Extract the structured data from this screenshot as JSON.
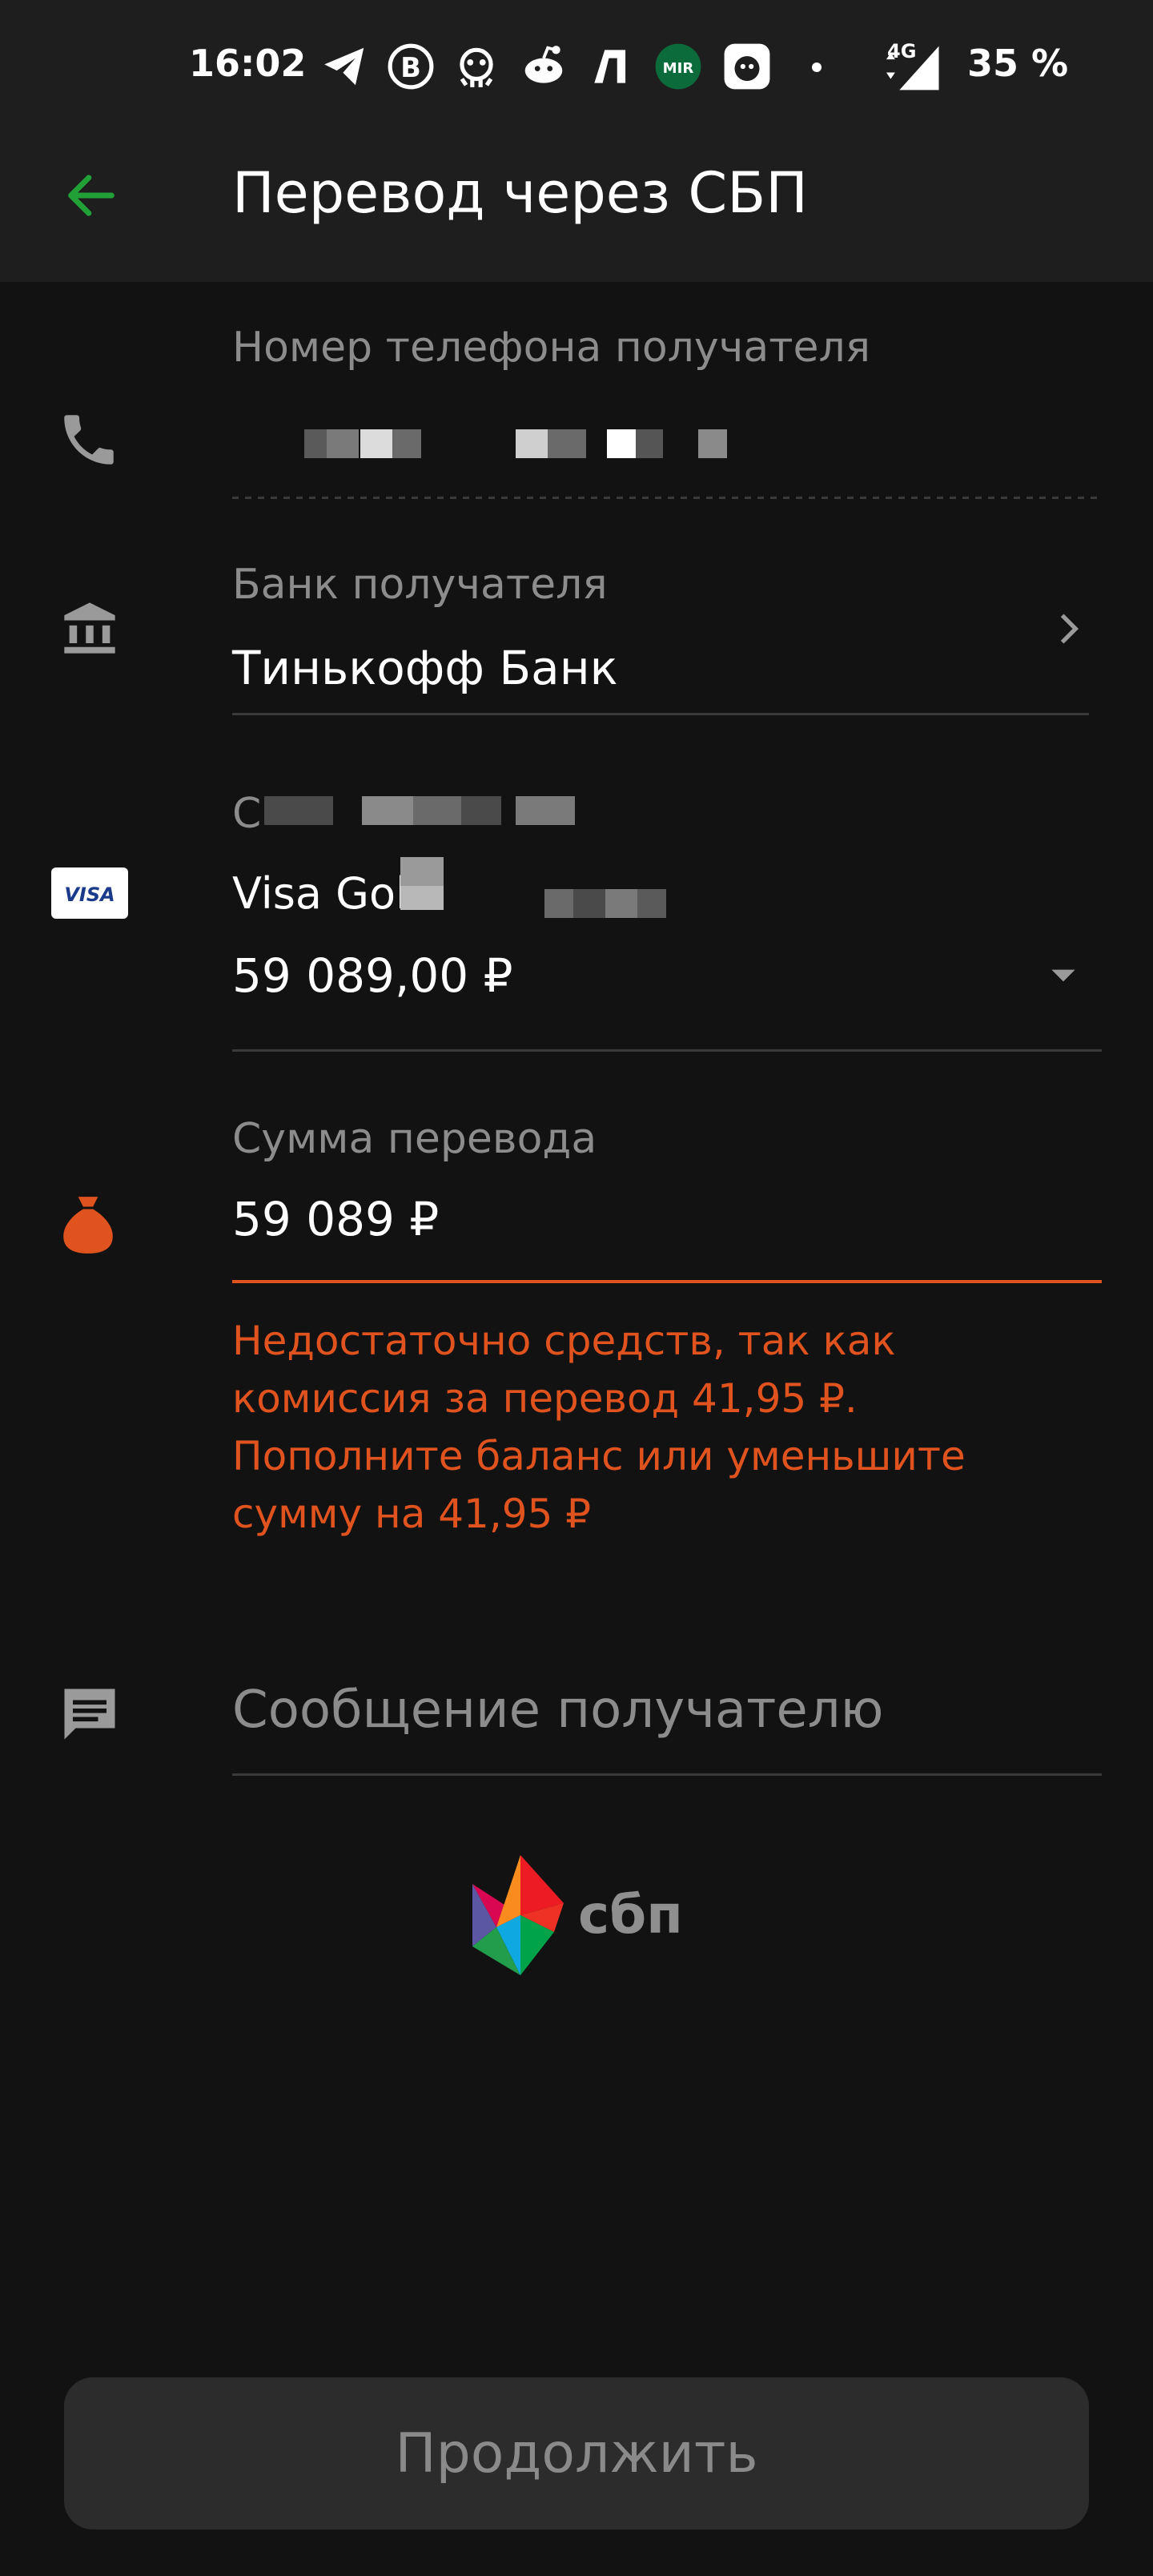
{
  "status_bar": {
    "time": "16:02",
    "network": "4G",
    "battery": "35 %",
    "icons": [
      "telegram-icon",
      "bitcoin-icon",
      "octopus-app-icon",
      "reddit-icon",
      "lamoda-icon",
      "mir-icon",
      "notification-app-icon",
      "dot-icon",
      "signal-icon"
    ]
  },
  "header": {
    "back_icon": "arrow-left-icon",
    "title": "Перевод через СБП"
  },
  "form": {
    "phone": {
      "label": "Номер телефона получателя",
      "icon": "phone-icon"
    },
    "bank": {
      "label": "Банк получателя",
      "value": "Тинькофф Банк",
      "icon": "bank-icon",
      "chevron": "chevron-right-icon"
    },
    "card": {
      "label_prefix": "С",
      "name": "Visa Gold",
      "balance": "59 089,00 ₽",
      "icon": "visa-card-icon",
      "dropdown": "dropdown-triangle-icon"
    },
    "amount": {
      "label": "Сумма перевода",
      "value": "59 089 ₽",
      "icon": "money-bag-icon"
    },
    "error_lines": [
      "Недостаточно средств, так как",
      "комиссия за перевод 41,95 ₽.",
      "Пополните баланс или уменьшите",
      "сумму на 41,95 ₽"
    ],
    "message": {
      "placeholder": "Сообщение получателю",
      "icon": "message-icon"
    }
  },
  "sbp_logo": {
    "text": "сбп"
  },
  "continue_button": {
    "label": "Продолжить"
  },
  "colors": {
    "accent_green": "#21a038",
    "error_orange": "#e0531f",
    "background": "#121212",
    "header": "#1e1e1e"
  }
}
